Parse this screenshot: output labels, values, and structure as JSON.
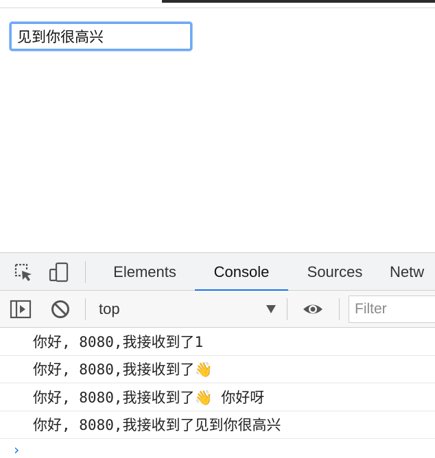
{
  "page": {
    "input_value": "见到你很高兴"
  },
  "devtools": {
    "tabs": [
      {
        "label": "Elements"
      },
      {
        "label": "Console"
      },
      {
        "label": "Sources"
      },
      {
        "label": "Netw"
      }
    ],
    "active_tab": "Console",
    "icons": {
      "inspect": "inspect-element-icon",
      "device": "device-toolbar-icon",
      "sidebar": "show-sidebar-icon",
      "clear": "clear-console-icon",
      "eye": "live-expression-eye-icon"
    },
    "accent_color": "#1a73e8",
    "toolbar": {
      "context": "top",
      "filter_placeholder": "Filter"
    },
    "console": {
      "messages": [
        "你好, 8080,我接收到了1",
        "你好, 8080,我接收到了👋",
        "你好, 8080,我接收到了👋 你好呀",
        "你好, 8080,我接收到了见到你很高兴"
      ],
      "prompt": "›"
    }
  }
}
